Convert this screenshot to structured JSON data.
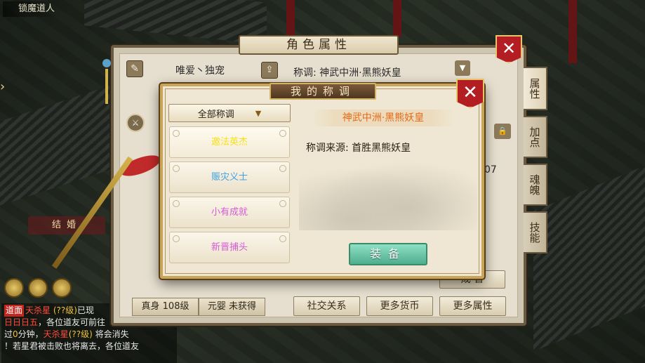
{
  "map": {
    "location_label": "锁魔道人"
  },
  "chat": {
    "lines": [
      {
        "tag": "道面",
        "name": "天杀星",
        "level": "(??级)",
        "text": "已现"
      },
      {
        "prefix": "日日日五",
        "text": "，各位道友可前往"
      },
      {
        "pre": "过",
        "num": "0",
        "text": "分钟，",
        "name": "天杀星",
        "level": "(??级)",
        "post": "将会消失"
      },
      {
        "text": "！若星君被击败也将离去，各位道友"
      }
    ]
  },
  "marry_label": "结婚",
  "attributes_window": {
    "title": "角色属性",
    "close_icon": "close-x-icon",
    "player_name": "唯爱丶独宠",
    "title_line": "称调: 神武中洲·黑熊妖皇",
    "peek_number": "07",
    "peek_button": "成 盲",
    "stage": {
      "real_body": "真身 108级",
      "primal": "元婴 未获得"
    },
    "bottom_buttons": [
      "社交关系",
      "更多货币",
      "更多属性"
    ],
    "side_tabs": [
      "属性",
      "加点",
      "魂魄",
      "技能"
    ]
  },
  "title_dialog": {
    "title": "我的称调",
    "filter": {
      "selected": "全部称调"
    },
    "titles": [
      {
        "label": "邀法英杰",
        "color": "#f5e214"
      },
      {
        "label": "赈灾义士",
        "color": "#3fa2e0"
      },
      {
        "label": "小有成就",
        "color": "#d65ad6"
      },
      {
        "label": "新晋捕头",
        "color": "#d65ad6"
      }
    ],
    "current_title": "神武中洲·黑熊妖皇",
    "source_label": "称调来源: 首胜黑熊妖皇",
    "equip_button": "装备"
  }
}
